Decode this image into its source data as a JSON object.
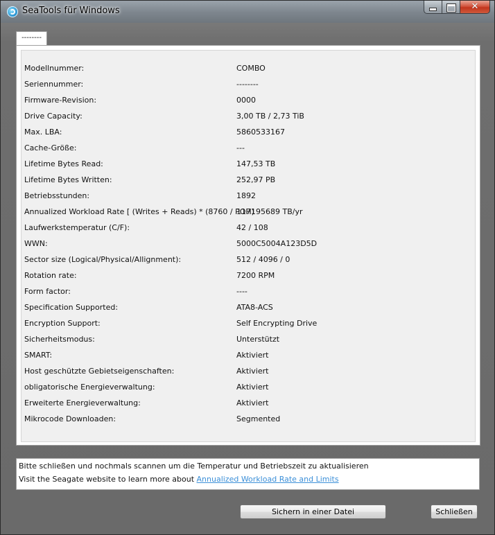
{
  "window": {
    "title": "SeaTools für Windows",
    "caption": {
      "minimize": "minimize",
      "maximize": "maximize",
      "close": "✕"
    }
  },
  "tab": {
    "label": "--------"
  },
  "details": [
    {
      "label": "Modellnummer:",
      "value": "COMBO"
    },
    {
      "label": "Seriennummer:",
      "value": "--------"
    },
    {
      "label": "Firmware-Revision:",
      "value": "0000"
    },
    {
      "label": "Drive Capacity:",
      "value": "3,00 TB / 2,73 TiB"
    },
    {
      "label": "Max. LBA:",
      "value": "5860533167"
    },
    {
      "label": "Cache-Größe:",
      "value": "---"
    },
    {
      "label": "Lifetime Bytes Read:",
      "value": "147,53  TB"
    },
    {
      "label": "Lifetime Bytes Written:",
      "value": "252,97  PB"
    },
    {
      "label": "Betriebsstunden:",
      "value": "1892"
    },
    {
      "label": "Annualized Workload Rate [ (Writes + Reads) * (8760 / POH)",
      "value": "117195689 TB/yr"
    },
    {
      "label": "Laufwerkstemperatur (C/F):",
      "value": "42 / 108"
    },
    {
      "label": "WWN:",
      "value": "5000C5004A123D5D"
    },
    {
      "label": "Sector size (Logical/Physical/Allignment):",
      "value": "512 / 4096 / 0"
    },
    {
      "label": "Rotation rate:",
      "value": "7200 RPM"
    },
    {
      "label": "Form factor:",
      "value": "----"
    },
    {
      "label": "Specification Supported:",
      "value": "ATA8-ACS"
    },
    {
      "label": "Encryption Support:",
      "value": "Self Encrypting Drive"
    },
    {
      "label": "Sicherheitsmodus:",
      "value": "Unterstützt"
    },
    {
      "label": "SMART:",
      "value": "Aktiviert"
    },
    {
      "label": "Host geschützte Gebietseigenschaften:",
      "value": "Aktiviert"
    },
    {
      "label": "obligatorische Energieverwaltung:",
      "value": "Aktiviert"
    },
    {
      "label": "Erweiterte Energieverwaltung:",
      "value": "Aktiviert"
    },
    {
      "label": "Mikrocode  Downloaden:",
      "value": "Segmented"
    }
  ],
  "info": {
    "line1": "Bitte schließen und nochmals scannen um die Temperatur und Betriebszeit zu aktualisieren",
    "line2_prefix": "Visit the Seagate website to learn more about ",
    "line2_link": "Annualized Workload Rate and Limits"
  },
  "buttons": {
    "save": "Sichern in einer Datei",
    "close": "Schließen"
  },
  "colors": {
    "link": "#3b8fd8",
    "titlebar": "#7f878f",
    "close_button": "#c2351d"
  },
  "icons": {
    "app": "seatools-logo-icon"
  }
}
